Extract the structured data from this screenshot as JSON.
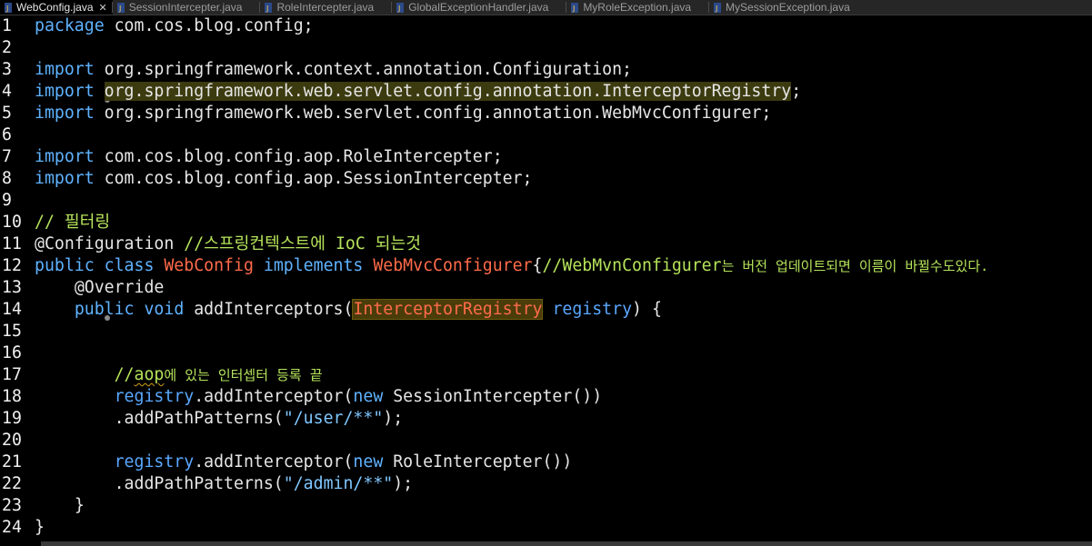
{
  "tabs": [
    {
      "label": "WebConfig.java",
      "active": true,
      "close": "✕"
    },
    {
      "label": "SessionIntercepter.java",
      "active": false
    },
    {
      "label": "RoleIntercepter.java",
      "active": false
    },
    {
      "label": "GlobalExceptionHandler.java",
      "active": false
    },
    {
      "label": "MyRoleException.java",
      "active": false
    },
    {
      "label": "MySessionException.java",
      "active": false
    }
  ],
  "lines": {
    "n1": "1",
    "n2": "2",
    "n3": "3",
    "n4": "4",
    "n5": "5",
    "n6": "6",
    "n7": "7",
    "n8": "8",
    "n9": "9",
    "n10": "10",
    "n11": "11",
    "n12": "12",
    "n13": "13",
    "n14": "14",
    "n15": "15",
    "n16": "16",
    "n17": "17",
    "n18": "18",
    "n19": "19",
    "n20": "20",
    "n21": "21",
    "n22": "22",
    "n23": "23",
    "n24": "24"
  },
  "code": {
    "kw_package": "package",
    "pkg_name": " com.cos.blog.config;",
    "kw_import": "import",
    "imp3": " org.springframework.context.annotation.Configuration;",
    "imp4_pre": " ",
    "imp4_hl": "org.springframework.web.servlet.config.annotation.InterceptorRegistry",
    "imp4_post": ";",
    "imp5_hl": "org.springframework.web.servlet.config.annotation.WebMvcConfigurer",
    "imp5_post": ";",
    "imp7": " com.cos.blog.config.aop.RoleIntercepter;",
    "imp8": " com.cos.blog.config.aop.SessionIntercepter;",
    "c10": "// 필터링",
    "l11_annot": "@Configuration",
    "l11_comment_a": " //스프링컨텍스트에 ",
    "l11_comment_b": "IoC",
    "l11_comment_c": " 되는것",
    "l12_public": "public",
    "l12_class": "class",
    "l12_name": "WebConfig",
    "l12_implements": "implements",
    "l12_iface": "WebMvcConfigurer",
    "l12_brace": "{",
    "l12_comment_a": "//WebMvnConfigurer",
    "l12_comment_b": "는 버전 업데이트되면 이름이 바뀔수도있다.",
    "l13_annot": "@Override",
    "l14_public": "public",
    "l14_void": "void",
    "l14_method": " addInterceptors(",
    "l14_type": "InterceptorRegistry",
    "l14_param": "registry",
    "l14_end": ") {",
    "l17_comment_a": "//",
    "l17_comment_b": "aop",
    "l17_comment_c": "에 있는 인터셉터 등록 끝",
    "l18_field": "registry",
    "l18_call": ".addInterceptor(",
    "l18_new": "new",
    "l18_class": " SessionIntercepter())",
    "l19_call": ".addPathPatterns(",
    "l19_str": "\"/user/**\"",
    "l19_end": ");",
    "l21_field": "registry",
    "l21_call": ".addInterceptor(",
    "l21_new": "new",
    "l21_class": " RoleIntercepter())",
    "l22_call": ".addPathPatterns(",
    "l22_str": "\"/admin/**\"",
    "l22_end": ");",
    "l23": "}",
    "l24": "}"
  },
  "colors": {
    "background": "#000000",
    "keyword": "#5fb3ff",
    "comment": "#b5e35a",
    "class_highlight": "#ff6b4a",
    "occurrence_highlight": "#3c3b10"
  },
  "icons": {
    "java_file": "java-file-icon",
    "fold": "fold-collapse-icon"
  }
}
